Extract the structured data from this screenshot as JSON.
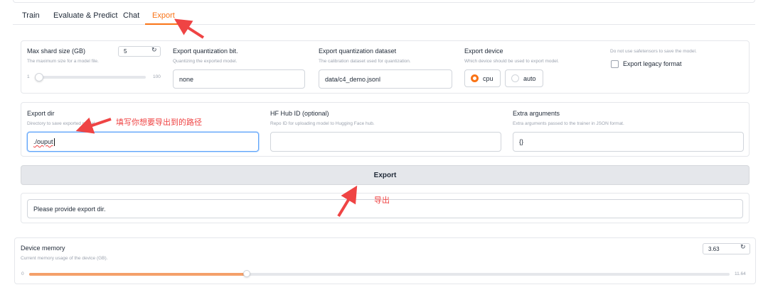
{
  "tabs": [
    {
      "label": "Train"
    },
    {
      "label": "Evaluate & Predict"
    },
    {
      "label": "Chat"
    },
    {
      "label": "Export",
      "active": true
    }
  ],
  "export_settings": {
    "shard_size": {
      "label": "Max shard size (GB)",
      "description": "The maximum size for a model file.",
      "value": "5",
      "min": "1",
      "max": "100",
      "level": 5
    },
    "quant_bit": {
      "label": "Export quantization bit.",
      "description": "Quantizing the exported model.",
      "value": "none"
    },
    "quant_dataset": {
      "label": "Export quantization dataset",
      "description": "The calibration dataset used for quantization.",
      "value": "data/c4_demo.jsonl"
    },
    "export_device": {
      "label": "Export device",
      "description": "Which device should be used to export model.",
      "options": [
        "cpu",
        "auto"
      ],
      "selected": "cpu"
    },
    "legacy_format": {
      "description": "Do not use safetensors to save the model.",
      "label": "Export legacy format",
      "checked": false
    }
  },
  "export_paths": {
    "export_dir": {
      "label": "Export dir",
      "description": "Directory to save exported model.",
      "value": "./ouput"
    },
    "hub_id": {
      "label": "HF Hub ID (optional)",
      "description": "Repo ID for uploading model to Hugging Face hub.",
      "value": ""
    },
    "extra_args": {
      "label": "Extra arguments",
      "description": "Extra arguments passed to the trainer in JSON format.",
      "value": "{}"
    }
  },
  "export_button": {
    "label": "Export"
  },
  "output": {
    "message": "Please provide export dir."
  },
  "device_memory": {
    "label": "Device memory",
    "description": "Current memory usage of the device (GB).",
    "value": "3.63",
    "min": "0",
    "max": "11.64",
    "level": 3.63
  },
  "annotations": {
    "export_dir_note": "填写你想要导出到的路径",
    "export_note": "导出"
  },
  "colors": {
    "accent": "#f97316",
    "annotation": "#ef4444",
    "focus": "#60a5fa"
  }
}
